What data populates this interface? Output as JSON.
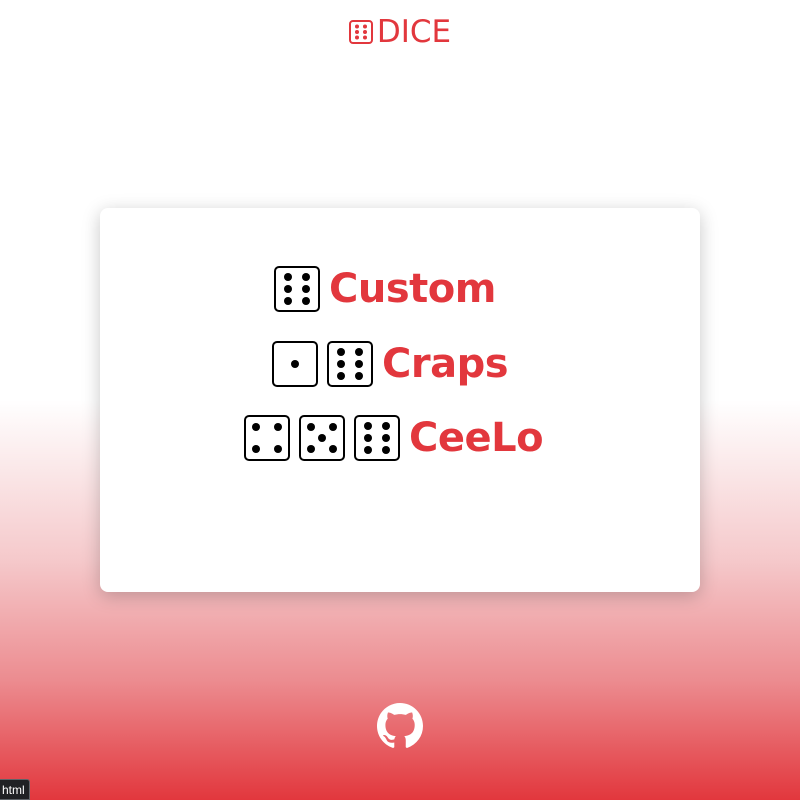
{
  "header": {
    "logo_icon": "dice-six-icon",
    "title": "DICE"
  },
  "menu": {
    "items": [
      {
        "label": "Custom",
        "dice": [
          6
        ]
      },
      {
        "label": "Craps",
        "dice": [
          1,
          6
        ]
      },
      {
        "label": "CeeLo",
        "dice": [
          4,
          5,
          6
        ]
      }
    ]
  },
  "footer": {
    "icon": "github-icon"
  },
  "status_bar": {
    "text": "html"
  },
  "colors": {
    "accent": "#e2373d",
    "card": "#ffffff",
    "pip": "#000000"
  }
}
